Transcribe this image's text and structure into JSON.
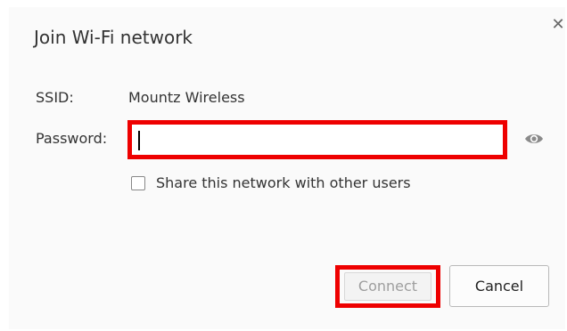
{
  "dialog": {
    "title": "Join Wi-Fi network",
    "close_icon": "close-icon",
    "ssid": {
      "label": "SSID:",
      "value": "Mountz Wireless"
    },
    "password": {
      "label": "Password:",
      "value": "",
      "placeholder": "",
      "reveal_icon": "eye-icon"
    },
    "share": {
      "label": "Share this network with other users",
      "checked": false
    },
    "buttons": {
      "connect_label": "Connect",
      "cancel_label": "Cancel"
    },
    "colors": {
      "highlight": "#ee0000",
      "background": "#fafafa",
      "disabled_text": "#9e9e9e"
    }
  }
}
